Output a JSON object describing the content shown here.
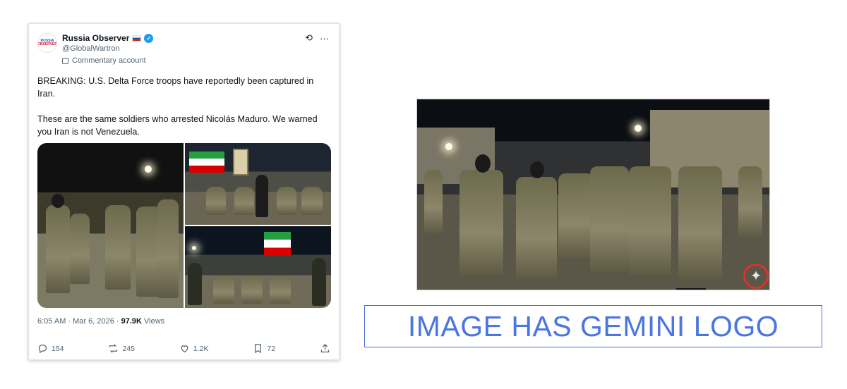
{
  "tweet": {
    "display_name": "Russia Observer",
    "handle": "@GlobalWartron",
    "account_label": "Commentary account",
    "avatar_text": [
      "RUSSIA",
      "OBSERVER"
    ],
    "text_1": "BREAKING: U.S. Delta Force troops have reportedly been captured in Iran.",
    "text_2": "These are the same soldiers who arrested Nicolás Maduro. We warned you Iran is not Venezuela.",
    "time": "6:05 AM · Mar 6, 2026 · ",
    "views_count": "97.9K",
    "views_label": " Views",
    "actions": {
      "replies": "154",
      "reposts": "245",
      "likes": "1.2K",
      "bookmarks": "72"
    },
    "icons": [
      "grok-icon",
      "more-icon",
      "reply-icon",
      "repost-icon",
      "like-icon",
      "bookmark-icon",
      "share-icon",
      "verified-icon",
      "russia-flag-icon"
    ]
  },
  "annotation": {
    "label": "IMAGE HAS GEMINI LOGO",
    "highlight_color": "#d9342b",
    "label_color": "#4a76e0"
  }
}
